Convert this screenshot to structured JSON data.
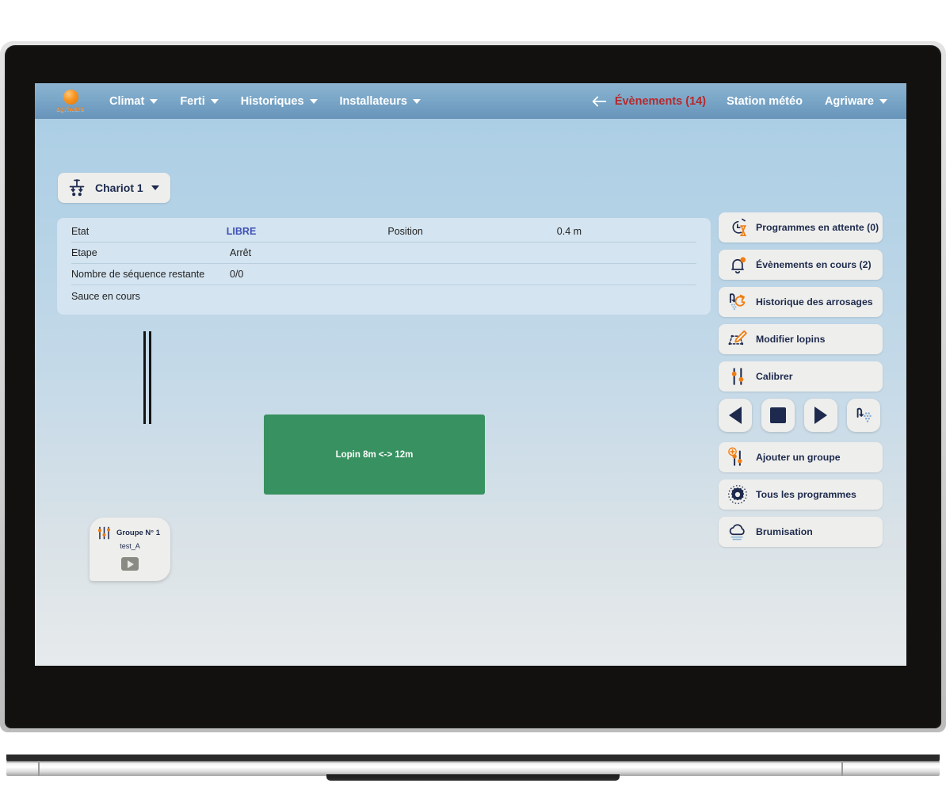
{
  "navbar": {
    "brand": {
      "name": "agriware",
      "icon": "agriware-logo-icon"
    },
    "menu_items": [
      {
        "label": "Climat",
        "icon": "chevron-down-icon"
      },
      {
        "label": "Ferti",
        "icon": "chevron-down-icon"
      },
      {
        "label": "Historiques",
        "icon": "chevron-down-icon"
      },
      {
        "label": "Installateurs",
        "icon": "chevron-down-icon"
      }
    ],
    "back_arrow": "←",
    "events_label": "Évènements (14)",
    "events_color": "#b5292c",
    "weather_station_label": "Station météo",
    "account_label": "Agriware"
  },
  "chariot_selector": {
    "label": "Chariot 1",
    "icon": "chariot-icon"
  },
  "info_panel": {
    "rows": [
      {
        "label": "Etat",
        "value": "LIBRE",
        "value_highlight": true,
        "label2": "Position",
        "value2": "0.4 m"
      },
      {
        "label": "Etape",
        "value": "Arrêt",
        "value_highlight": false,
        "label2": "",
        "value2": ""
      },
      {
        "label": "Nombre de séquence restante",
        "value": "0/0",
        "value_highlight": false,
        "label2": "",
        "value2": ""
      },
      {
        "label": "Sauce en cours",
        "value": "",
        "value_highlight": false,
        "label2": "",
        "value2": ""
      }
    ]
  },
  "canvas": {
    "lopin": {
      "label": "Lopin 8m <-> 12m",
      "color": "#389160"
    },
    "group_card": {
      "title": "Groupe N° 1",
      "subtitle": "test_A",
      "icon": "sliders-icon",
      "play_icon": "play-icon"
    },
    "rail": {
      "name": "chariot-rail"
    }
  },
  "sidebar": {
    "buttons": [
      {
        "label": "Programmes en attente (0)",
        "icon": "stopwatch-hourglass-icon"
      },
      {
        "label": "Évènements en cours (2)",
        "icon": "bell-alert-icon"
      },
      {
        "label": "Historique des arrosages",
        "icon": "shower-history-icon"
      },
      {
        "label": "Modifier lopins",
        "icon": "edit-plot-icon"
      },
      {
        "label": "Calibrer",
        "icon": "sliders-icon"
      }
    ],
    "media_controls": [
      {
        "name": "move-left-button",
        "icon": "triangle-left-icon"
      },
      {
        "name": "stop-button",
        "icon": "square-stop-icon"
      },
      {
        "name": "move-right-button",
        "icon": "triangle-right-icon"
      },
      {
        "name": "watering-button",
        "icon": "shower-icon"
      }
    ],
    "buttons_bottom": [
      {
        "label": "Ajouter un groupe",
        "icon": "add-sliders-icon"
      },
      {
        "label": "Tous les programmes",
        "icon": "gear-icon"
      },
      {
        "label": "Brumisation",
        "icon": "cloud-mist-icon"
      }
    ]
  },
  "theme": {
    "accent_orange": "#f07d12",
    "navy": "#1d2a4d",
    "panel_blue": "#d4e4f0",
    "green": "#389160"
  }
}
